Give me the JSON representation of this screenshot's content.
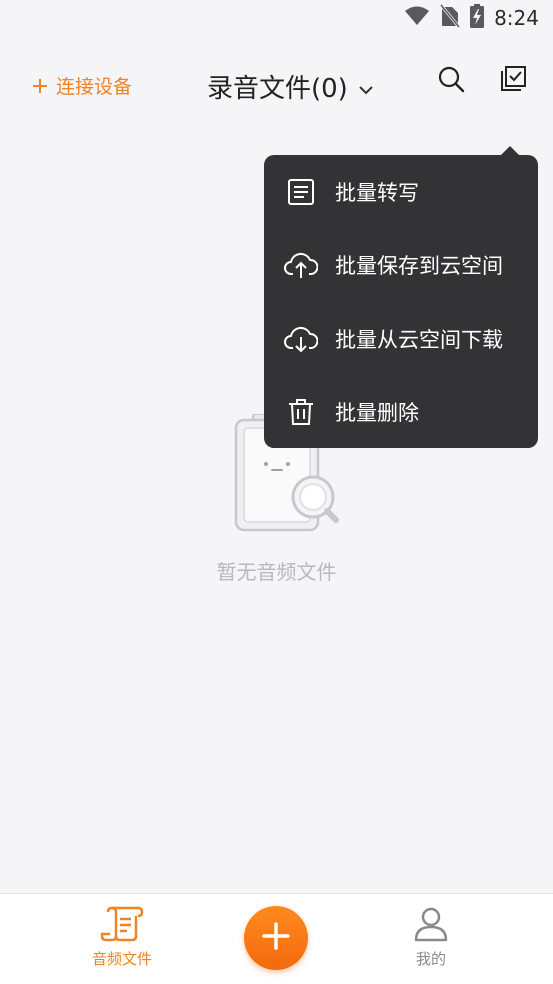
{
  "status_bar": {
    "time": "8:24",
    "icons": [
      "wifi-icon",
      "no-sim-icon",
      "battery-charging-icon"
    ]
  },
  "header": {
    "connect_label": "连接设备",
    "title": "录音文件(0)",
    "search_icon": "search-icon",
    "multiselect_icon": "multi-select-icon"
  },
  "menu": {
    "items": [
      {
        "label": "批量转写",
        "icon": "document-lines-icon"
      },
      {
        "label": "批量保存到云空间",
        "icon": "cloud-upload-icon"
      },
      {
        "label": "批量从云空间下载",
        "icon": "cloud-download-icon"
      },
      {
        "label": "批量删除",
        "icon": "trash-icon"
      }
    ]
  },
  "empty_state": {
    "text": "暂无音频文件",
    "icon": "empty-clipboard-search-icon"
  },
  "bottom_nav": {
    "items": [
      {
        "label": "音频文件",
        "icon": "audio-file-icon",
        "active": true
      },
      {
        "label": "我的",
        "icon": "person-icon",
        "active": false
      }
    ],
    "fab_icon": "plus-icon"
  },
  "colors": {
    "accent": "#f08424",
    "background": "#f5f5f7",
    "menu_bg": "#333335",
    "muted_text": "#b8b8bd",
    "inactive_nav": "#8a8a8e"
  }
}
